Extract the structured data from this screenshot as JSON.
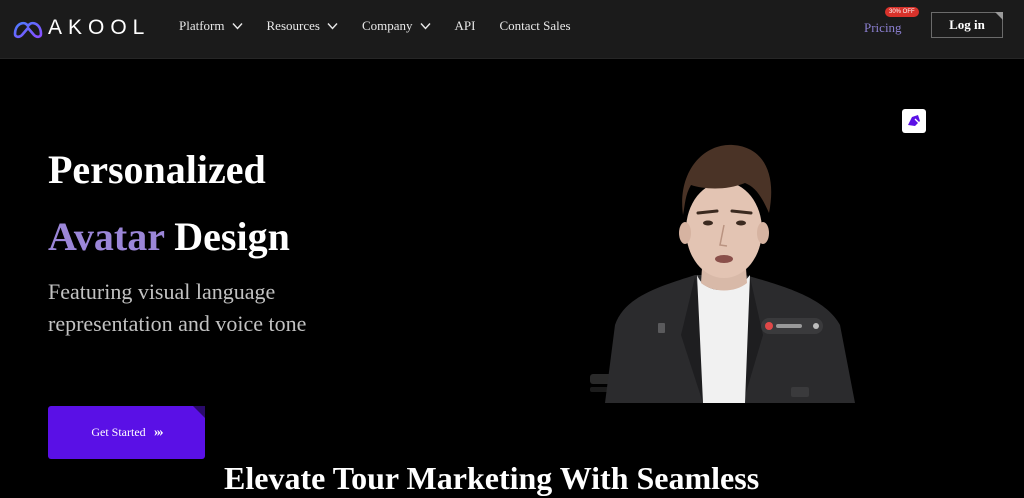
{
  "brand": {
    "name": "AKOOL"
  },
  "nav": {
    "items": [
      {
        "label": "Platform",
        "has_dropdown": true
      },
      {
        "label": "Resources",
        "has_dropdown": true
      },
      {
        "label": "Company",
        "has_dropdown": true
      },
      {
        "label": "API",
        "has_dropdown": false
      },
      {
        "label": "Contact Sales",
        "has_dropdown": false
      }
    ],
    "pricing_label": "Pricing",
    "pricing_badge": "30% OFF",
    "login_label": "Log in"
  },
  "hero": {
    "title_line1": "Personalized",
    "title_accent": "Avatar",
    "title_rest": "Design",
    "subtitle": "Featuring visual language representation and voice tone",
    "cta_label": "Get Started",
    "cta_icon": "double-chevron-right-icon"
  },
  "section": {
    "title": "Elevate Tour Marketing With Seamless"
  },
  "icons": {
    "app_icon": "pencil-edit-icon"
  },
  "colors": {
    "nav_bg": "#1b1b1b",
    "accent_text": "#9b86d8",
    "cta_bg": "#5a10e6",
    "pricing": "#8b7fd0",
    "badge": "#d8322b"
  }
}
